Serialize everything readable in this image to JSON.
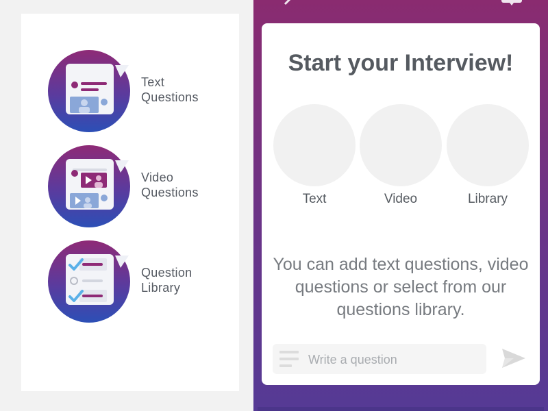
{
  "left_panel": {
    "features": [
      {
        "line1": "Text",
        "line2": "Questions",
        "icon": "text-questions-icon"
      },
      {
        "line1": "Video",
        "line2": "Questions",
        "icon": "video-questions-icon"
      },
      {
        "line1": "Question",
        "line2": "Library",
        "icon": "question-library-icon"
      }
    ]
  },
  "card": {
    "title": "Start your Interview!",
    "options": [
      {
        "label": "Text"
      },
      {
        "label": "Video"
      },
      {
        "label": "Library"
      }
    ],
    "description": "You can add text questions, video questions or select from our questions library."
  },
  "composer": {
    "placeholder": "Write a question",
    "send_icon": "send-icon"
  },
  "colors": {
    "brand_purple": "#8a2b70",
    "brand_blue": "#2c4fb6",
    "card_bg": "#ffffff",
    "circle_placeholder": "#f1f1f1"
  }
}
